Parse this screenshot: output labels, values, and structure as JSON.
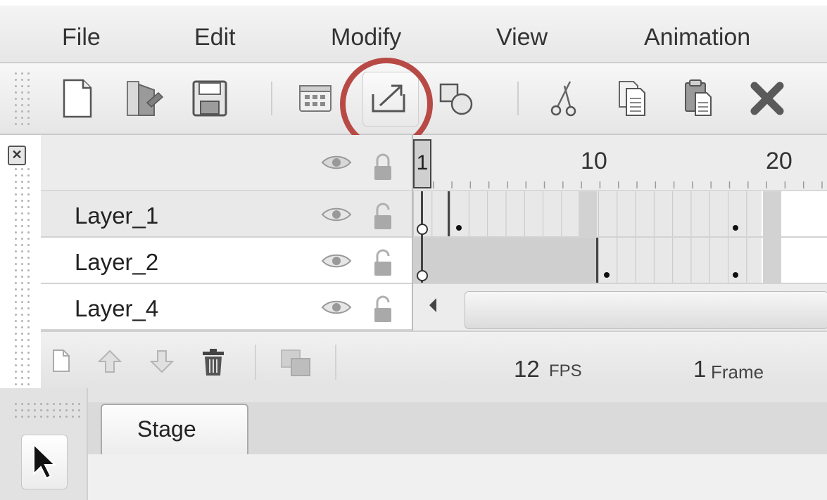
{
  "menu": {
    "items": [
      "File",
      "Edit",
      "Modify",
      "View",
      "Animation"
    ]
  },
  "toolbar": {
    "buttons": [
      {
        "name": "new-document-icon"
      },
      {
        "name": "open-folder-icon"
      },
      {
        "name": "save-disk-icon"
      },
      {
        "name": "grid-settings-icon"
      },
      {
        "name": "export-icon"
      },
      {
        "name": "shapes-icon"
      },
      {
        "name": "scissors-icon"
      },
      {
        "name": "copy-icon"
      },
      {
        "name": "paste-icon"
      },
      {
        "name": "delete-x-icon"
      }
    ],
    "highlight_color": "#b84a46"
  },
  "timeline": {
    "ruler": {
      "playhead": "1",
      "labels": [
        "10",
        "20"
      ]
    },
    "layers": [
      {
        "name": "Layer_1"
      },
      {
        "name": "Layer_2"
      },
      {
        "name": "Layer_4"
      }
    ],
    "footer": {
      "fps_value": "12",
      "fps_unit": "FPS",
      "frame_value": "1",
      "frame_unit": "Frame"
    }
  },
  "stage": {
    "tab_label": "Stage"
  }
}
